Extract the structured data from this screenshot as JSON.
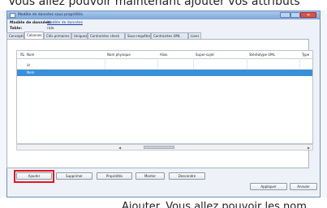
{
  "snippet_top": "Vous allez pouvoir maintenant ajouter vos attributs",
  "snippet_bottom": "Ajouter. Vous allez pouvoir les nom",
  "window": {
    "title": "Modèle de données sous propriétés"
  },
  "info": {
    "domain_label": "Modèle de données:",
    "domain_value": "Modèle de données",
    "table_label": "Table:",
    "table_value": "role"
  },
  "tabs": [
    "Conception",
    "Colonnes",
    "Clés primaires",
    "Uniques",
    "Contraintes check",
    "Sous-requêtes",
    "Contraintes UML",
    "Liens"
  ],
  "grid": {
    "columns": [
      "Nom",
      "Nom physique",
      "Alias",
      "Super-sujet",
      "Stéréotype UML",
      "Type"
    ],
    "rows": [
      [
        "id",
        "",
        "",
        "",
        "",
        ""
      ],
      [
        "Nom",
        "",
        "",
        "",
        "",
        ""
      ]
    ],
    "selected_row": 1
  },
  "buttons": {
    "add": "Ajouter",
    "delete": "Supprimer",
    "properties": "Propriétés",
    "up": "Monter",
    "down": "Descendre",
    "apply": "Appliquer",
    "cancel": "Annuler"
  }
}
